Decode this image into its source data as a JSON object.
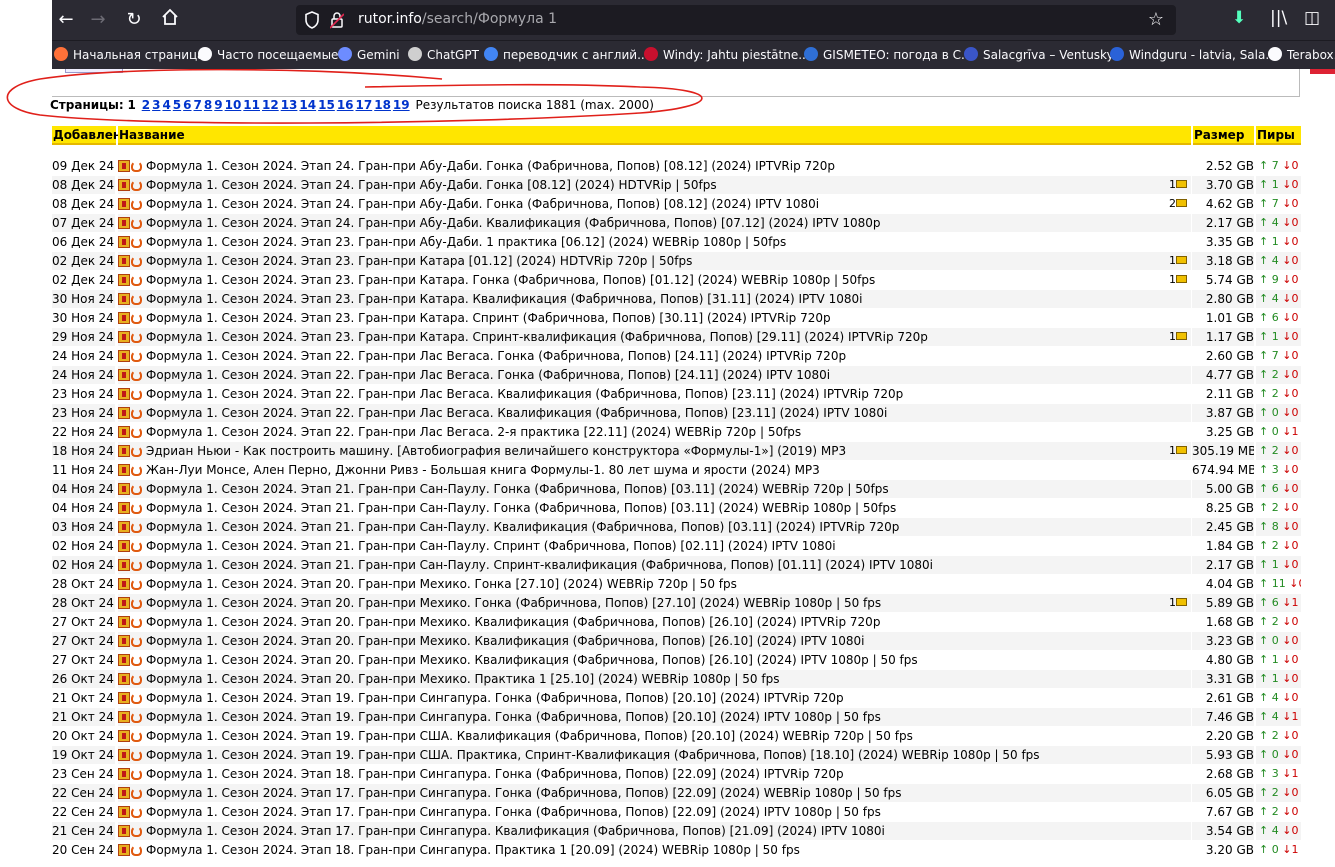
{
  "browser": {
    "url_host": "rutor.info",
    "url_path": "/search/Формула 1",
    "bookmarks": [
      {
        "label": "Начальная страница",
        "color": "#ff7139"
      },
      {
        "label": "Часто посещаемые",
        "color": "#fbfbfe"
      },
      {
        "label": "Gemini",
        "color": "#6d8cff"
      },
      {
        "label": "ChatGPT",
        "color": "#cfcfcf"
      },
      {
        "label": "переводчик с англий...",
        "color": "#4285f4"
      },
      {
        "label": "Windy: Jahtu piestātne...",
        "color": "#c8102e"
      },
      {
        "label": "GISMETEO: погода в С...",
        "color": "#2f6fd6"
      },
      {
        "label": "Salacgrīva – Ventusky",
        "color": "#3a55c8"
      },
      {
        "label": "Windguru - latvia, Sala...",
        "color": "#2a62d8"
      },
      {
        "label": "Terabox.c",
        "color": "#fbfbfe"
      }
    ]
  },
  "pager": {
    "label": "Страницы:",
    "current": "1",
    "pages": [
      "2",
      "3",
      "4",
      "5",
      "6",
      "7",
      "8",
      "9",
      "10",
      "11",
      "12",
      "13",
      "14",
      "15",
      "16",
      "17",
      "18",
      "19"
    ],
    "results": "Результатов поиска 1881 (max. 2000)"
  },
  "table": {
    "headers": {
      "date": "Добавлен",
      "name": "Название",
      "size": "Размер",
      "peers": "Пиры"
    },
    "rows": [
      {
        "date": "09 Дек 24",
        "name": "Формула 1. Сезон 2024. Этап 24. Гран-при Абу-Даби. Гонка (Фабричнова, Попов) [08.12] (2024) IPTVRip 720p",
        "comments": "",
        "size": "2.52 GB",
        "seeds": "7",
        "leech": "0"
      },
      {
        "date": "08 Дек 24",
        "name": "Формула 1. Сезон 2024. Этап 24. Гран-при Абу-Даби. Гонка [08.12] (2024) HDTVRip | 50fps",
        "comments": "1",
        "size": "3.70 GB",
        "seeds": "1",
        "leech": "0"
      },
      {
        "date": "08 Дек 24",
        "name": "Формула 1. Сезон 2024. Этап 24. Гран-при Абу-Даби. Гонка (Фабричнова, Попов) [08.12] (2024) IPTV 1080i",
        "comments": "2",
        "size": "4.62 GB",
        "seeds": "7",
        "leech": "0"
      },
      {
        "date": "07 Дек 24",
        "name": "Формула 1. Сезон 2024. Этап 24. Гран-при Абу-Даби. Квалификация (Фабричнова, Попов) [07.12] (2024) IPTV 1080p",
        "comments": "",
        "size": "2.17 GB",
        "seeds": "4",
        "leech": "0"
      },
      {
        "date": "06 Дек 24",
        "name": "Формула 1. Сезон 2024. Этап 23. Гран-при Абу-Даби. 1 практика [06.12] (2024) WEBRip 1080p | 50fps",
        "comments": "",
        "size": "3.35 GB",
        "seeds": "1",
        "leech": "0"
      },
      {
        "date": "02 Дек 24",
        "name": "Формула 1. Сезон 2024. Этап 23. Гран-при Катара [01.12] (2024) HDTVRip 720p | 50fps",
        "comments": "1",
        "size": "3.18 GB",
        "seeds": "4",
        "leech": "0"
      },
      {
        "date": "02 Дек 24",
        "name": "Формула 1. Сезон 2024. Этап 23. Гран-при Катара. Гонка (Фабричнова, Попов) [01.12] (2024) WEBRip 1080p | 50fps",
        "comments": "1",
        "size": "5.74 GB",
        "seeds": "9",
        "leech": "0"
      },
      {
        "date": "30 Ноя 24",
        "name": "Формула 1. Сезон 2024. Этап 23. Гран-при Катара. Квалификация (Фабричнова, Попов) [31.11] (2024) IPTV 1080i",
        "comments": "",
        "size": "2.80 GB",
        "seeds": "4",
        "leech": "0"
      },
      {
        "date": "30 Ноя 24",
        "name": "Формула 1. Сезон 2024. Этап 23. Гран-при Катара. Спринт (Фабричнова, Попов) [30.11] (2024) IPTVRip 720p",
        "comments": "",
        "size": "1.01 GB",
        "seeds": "6",
        "leech": "0"
      },
      {
        "date": "29 Ноя 24",
        "name": "Формула 1. Сезон 2024. Этап 23. Гран-при Катара. Спринт-квалификация (Фабричнова, Попов) [29.11] (2024) IPTVRip 720p",
        "comments": "1",
        "size": "1.17 GB",
        "seeds": "1",
        "leech": "0"
      },
      {
        "date": "24 Ноя 24",
        "name": "Формула 1. Сезон 2024. Этап 22. Гран-при Лас Вегаса. Гонка (Фабричнова, Попов) [24.11] (2024) IPTVRip 720p",
        "comments": "",
        "size": "2.60 GB",
        "seeds": "7",
        "leech": "0"
      },
      {
        "date": "24 Ноя 24",
        "name": "Формула 1. Сезон 2024. Этап 22. Гран-при Лас Вегаса. Гонка (Фабричнова, Попов) [24.11] (2024) IPTV 1080i",
        "comments": "",
        "size": "4.77 GB",
        "seeds": "2",
        "leech": "0"
      },
      {
        "date": "23 Ноя 24",
        "name": "Формула 1. Сезон 2024. Этап 22. Гран-при Лас Вегаса. Квалификация (Фабричнова, Попов) [23.11] (2024) IPTVRip 720p",
        "comments": "",
        "size": "2.11 GB",
        "seeds": "2",
        "leech": "0"
      },
      {
        "date": "23 Ноя 24",
        "name": "Формула 1. Сезон 2024. Этап 22. Гран-при Лас Вегаса. Квалификация (Фабричнова, Попов) [23.11] (2024) IPTV 1080i",
        "comments": "",
        "size": "3.87 GB",
        "seeds": "0",
        "leech": "0"
      },
      {
        "date": "22 Ноя 24",
        "name": "Формула 1. Сезон 2024. Этап 22. Гран-при Лас Вегаса. 2-я практика [22.11] (2024) WEBRip 720p | 50fps",
        "comments": "",
        "size": "3.25 GB",
        "seeds": "0",
        "leech": "1"
      },
      {
        "date": "18 Ноя 24",
        "name": "Эдриан Ньюи - Как построить машину. [Автобиография величайшего конструктора «Формулы-1»] (2019) MP3",
        "comments": "1",
        "size": "305.19 MB",
        "seeds": "2",
        "leech": "0"
      },
      {
        "date": "11 Ноя 24",
        "name": "Жан-Луи Монсе, Ален Перно, Джонни Ривз - Большая книга Формулы-1. 80 лет шума и ярости (2024) MP3",
        "comments": "",
        "size": "674.94 MB",
        "seeds": "3",
        "leech": "0"
      },
      {
        "date": "04 Ноя 24",
        "name": "Формула 1. Сезон 2024. Этап 21. Гран-при Сан-Паулу. Гонка (Фабричнова, Попов) [03.11] (2024) WEBRip 720p | 50fps",
        "comments": "",
        "size": "5.00 GB",
        "seeds": "6",
        "leech": "0"
      },
      {
        "date": "04 Ноя 24",
        "name": "Формула 1. Сезон 2024. Этап 21. Гран-при Сан-Паулу. Гонка (Фабричнова, Попов) [03.11] (2024) WEBRip 1080p | 50fps",
        "comments": "",
        "size": "8.25 GB",
        "seeds": "2",
        "leech": "0"
      },
      {
        "date": "03 Ноя 24",
        "name": "Формула 1. Сезон 2024. Этап 21. Гран-при Сан-Паулу. Квалификация (Фабричнова, Попов) [03.11] (2024) IPTVRip 720p",
        "comments": "",
        "size": "2.45 GB",
        "seeds": "8",
        "leech": "0"
      },
      {
        "date": "02 Ноя 24",
        "name": "Формула 1. Сезон 2024. Этап 21. Гран-при Сан-Паулу. Спринт (Фабричнова, Попов) [02.11] (2024) IPTV 1080i",
        "comments": "",
        "size": "1.84 GB",
        "seeds": "2",
        "leech": "0"
      },
      {
        "date": "02 Ноя 24",
        "name": "Формула 1. Сезон 2024. Этап 21. Гран-при Сан-Паулу. Спринт-квалификация (Фабричнова, Попов) [01.11] (2024) IPTV 1080i",
        "comments": "",
        "size": "2.17 GB",
        "seeds": "1",
        "leech": "0"
      },
      {
        "date": "28 Окт 24",
        "name": "Формула 1. Сезон 2024. Этап 20. Гран-при Мехико. Гонка [27.10] (2024) WEBRip 720p | 50 fps",
        "comments": "",
        "size": "4.04 GB",
        "seeds": "11",
        "leech": "0"
      },
      {
        "date": "28 Окт 24",
        "name": "Формула 1. Сезон 2024. Этап 20. Гран-при Мехико. Гонка (Фабричнова, Попов) [27.10] (2024) WEBRip 1080p | 50 fps",
        "comments": "1",
        "size": "5.89 GB",
        "seeds": "6",
        "leech": "1"
      },
      {
        "date": "27 Окт 24",
        "name": "Формула 1. Сезон 2024. Этап 20. Гран-при Мехико. Квалификация (Фабричнова, Попов) [26.10] (2024) IPTVRip 720p",
        "comments": "",
        "size": "1.68 GB",
        "seeds": "2",
        "leech": "0"
      },
      {
        "date": "27 Окт 24",
        "name": "Формула 1. Сезон 2024. Этап 20. Гран-при Мехико. Квалификация (Фабричнова, Попов) [26.10] (2024) IPTV 1080i",
        "comments": "",
        "size": "3.23 GB",
        "seeds": "0",
        "leech": "0"
      },
      {
        "date": "27 Окт 24",
        "name": "Формула 1. Сезон 2024. Этап 20. Гран-при Мехико. Квалификация (Фабричнова, Попов) [26.10] (2024) IPTV 1080p | 50 fps",
        "comments": "",
        "size": "4.80 GB",
        "seeds": "1",
        "leech": "0"
      },
      {
        "date": "26 Окт 24",
        "name": "Формула 1. Сезон 2024. Этап 20. Гран-при Мехико. Практика 1 [25.10] (2024) WEBRip 1080p | 50 fps",
        "comments": "",
        "size": "3.31 GB",
        "seeds": "1",
        "leech": "0"
      },
      {
        "date": "21 Окт 24",
        "name": "Формула 1. Сезон 2024. Этап 19. Гран-при Сингапура. Гонка (Фабричнова, Попов) [20.10] (2024) IPTVRip 720p",
        "comments": "",
        "size": "2.61 GB",
        "seeds": "4",
        "leech": "0"
      },
      {
        "date": "21 Окт 24",
        "name": "Формула 1. Сезон 2024. Этап 19. Гран-при Сингапура. Гонка (Фабричнова, Попов) [20.10] (2024) IPTV 1080p | 50 fps",
        "comments": "",
        "size": "7.46 GB",
        "seeds": "4",
        "leech": "1"
      },
      {
        "date": "20 Окт 24",
        "name": "Формула 1. Сезон 2024. Этап 19. Гран-при США. Квалификация (Фабричнова, Попов) [20.10] (2024) WEBRip 720p | 50 fps",
        "comments": "",
        "size": "2.20 GB",
        "seeds": "2",
        "leech": "0"
      },
      {
        "date": "19 Окт 24",
        "name": "Формула 1. Сезон 2024. Этап 19. Гран-при США. Практика, Спринт-Квалификация (Фабричнова, Попов) [18.10] (2024) WEBRip 1080p | 50 fps",
        "comments": "",
        "size": "5.93 GB",
        "seeds": "0",
        "leech": "0"
      },
      {
        "date": "23 Сен 24",
        "name": "Формула 1. Сезон 2024. Этап 18. Гран-при Сингапура. Гонка (Фабричнова, Попов) [22.09] (2024) IPTVRip 720p",
        "comments": "",
        "size": "2.68 GB",
        "seeds": "3",
        "leech": "1"
      },
      {
        "date": "22 Сен 24",
        "name": "Формула 1. Сезон 2024. Этап 17. Гран-при Сингапура. Гонка (Фабричнова, Попов) [22.09] (2024) WEBRip 1080p | 50 fps",
        "comments": "",
        "size": "6.05 GB",
        "seeds": "2",
        "leech": "0"
      },
      {
        "date": "22 Сен 24",
        "name": "Формула 1. Сезон 2024. Этап 17. Гран-при Сингапура. Гонка (Фабричнова, Попов) [22.09] (2024) IPTV 1080p | 50 fps",
        "comments": "",
        "size": "7.67 GB",
        "seeds": "2",
        "leech": "0"
      },
      {
        "date": "21 Сен 24",
        "name": "Формула 1. Сезон 2024. Этап 17. Гран-при Сингапура. Квалификация (Фабричнова, Попов) [21.09] (2024) IPTV 1080i",
        "comments": "",
        "size": "3.54 GB",
        "seeds": "4",
        "leech": "0"
      },
      {
        "date": "20 Сен 24",
        "name": "Формула 1. Сезон 2024. Этап 18. Гран-при Сингапура. Практика 1 [20.09] (2024) WEBRip 1080p | 50 fps",
        "comments": "",
        "size": "3.20 GB",
        "seeds": "0",
        "leech": "1"
      }
    ]
  }
}
